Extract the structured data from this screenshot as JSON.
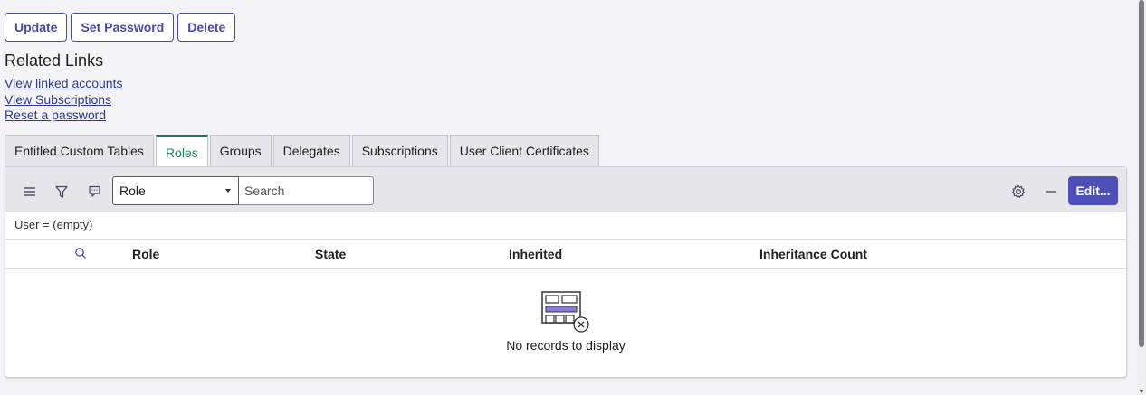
{
  "actions": {
    "update": "Update",
    "set_password": "Set Password",
    "delete": "Delete"
  },
  "related_links": {
    "title": "Related Links",
    "items": [
      "View linked accounts",
      "View Subscriptions",
      "Reset a password"
    ]
  },
  "tabs": [
    {
      "label": "Entitled Custom Tables",
      "active": false
    },
    {
      "label": "Roles",
      "active": true
    },
    {
      "label": "Groups",
      "active": false
    },
    {
      "label": "Delegates",
      "active": false
    },
    {
      "label": "Subscriptions",
      "active": false
    },
    {
      "label": "User Client Certificates",
      "active": false
    }
  ],
  "list": {
    "icons": [
      "hamburger-menu-icon",
      "filter-icon",
      "comment-icon",
      "gear-icon",
      "minimize-icon",
      "search-icon"
    ],
    "search_field_selected": "Role",
    "search_placeholder": "Search",
    "edit_label": "Edit...",
    "filter": "User = (empty)",
    "columns": [
      "Role",
      "State",
      "Inherited",
      "Inheritance Count"
    ],
    "empty_message": "No records to display"
  },
  "colors": {
    "accent": "#4f4fb8",
    "active_tab": "#1a7a55",
    "link": "#2e3a8c"
  }
}
